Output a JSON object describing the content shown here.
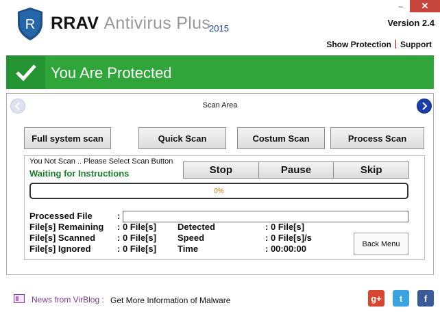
{
  "window": {
    "minimize_glyph": "–",
    "close_glyph": "✕"
  },
  "header": {
    "logo_letter": "R",
    "title_main": "RRAV",
    "title_sub": "Antivirus Plus",
    "year": "2015",
    "version": "Version 2.4",
    "links": [
      "Show Protection",
      "Support"
    ]
  },
  "banner": {
    "text": "You Are Protected",
    "color": "#2fa53a"
  },
  "scan_area": {
    "label": "Scan Area",
    "buttons": {
      "full": "Full system scan",
      "quick": "Quick Scan",
      "custom": "Costum Scan",
      "process": "Process Scan"
    }
  },
  "status": {
    "message": "You Not Scan .. Please Select Scan Button",
    "waiting": "Waiting for Instructions",
    "controls": [
      "Stop",
      "Pause",
      "Skip"
    ],
    "progress_text": "0%",
    "progress_value": 0
  },
  "stats": {
    "processed_file_label": "Processed File",
    "processed_file_colon": ":",
    "left": [
      {
        "label": "File[s] Remaining",
        "value": ": 0 File[s]"
      },
      {
        "label": "File[s] Scanned",
        "value": ": 0 File[s]"
      },
      {
        "label": "File[s] Ignored",
        "value": ": 0 File[s]"
      }
    ],
    "right": [
      {
        "label": "Detected",
        "value": ": 0 File[s]"
      },
      {
        "label": "Speed",
        "value": ": 0 File[s]/s"
      },
      {
        "label": "Time",
        "value": ": 00:00:00"
      }
    ],
    "back_menu": "Back Menu"
  },
  "footer": {
    "news_label": "News from VirBlog :",
    "news_text": "Get More Information of Malware",
    "social": {
      "google": "g+",
      "twitter": "t",
      "facebook": "f"
    }
  }
}
